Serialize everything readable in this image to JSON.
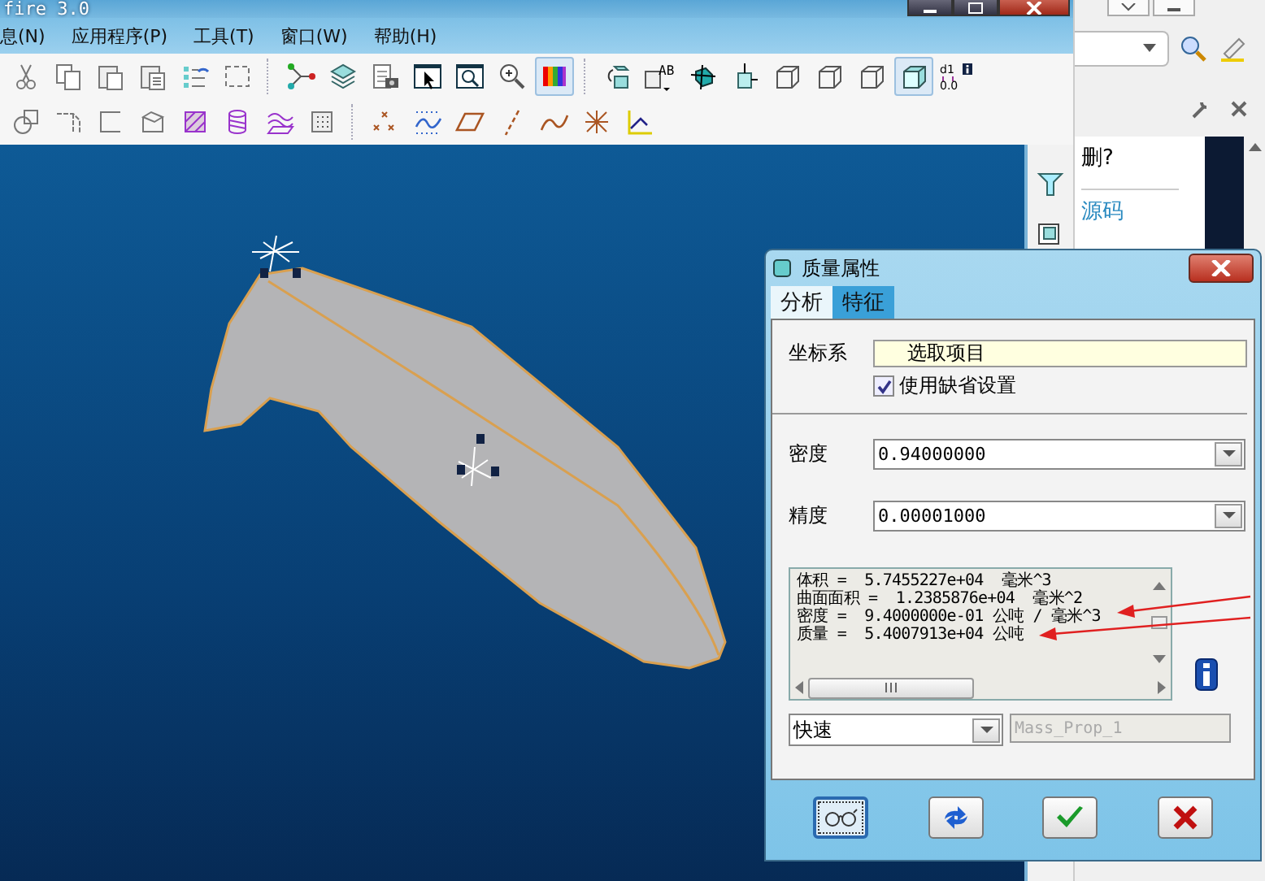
{
  "window": {
    "title": "fire 3.0"
  },
  "menu": [
    {
      "label": "息(N)"
    },
    {
      "label": "应用程序(P)"
    },
    {
      "label": "工具(T)"
    },
    {
      "label": "窗口(W)"
    },
    {
      "label": "帮助(H)"
    }
  ],
  "toolbars": [
    [
      {
        "kind": "scissors",
        "pressed": false
      },
      {
        "kind": "copy",
        "pressed": false
      },
      {
        "kind": "clipboard",
        "pressed": false
      },
      {
        "kind": "clipboard-list",
        "pressed": false
      },
      {
        "kind": "list-arrows",
        "pressed": false
      },
      {
        "kind": "dashed-rect",
        "pressed": false
      },
      {
        "kind": "node-graph",
        "pressed": false
      },
      {
        "kind": "layers",
        "pressed": false
      },
      {
        "kind": "table-camera",
        "pressed": false
      },
      {
        "kind": "cursor-window",
        "pressed": false
      },
      {
        "kind": "zoom-window",
        "pressed": false
      },
      {
        "kind": "zoom-in",
        "pressed": false
      },
      {
        "kind": "color-bars",
        "pressed": true
      },
      {
        "kind": "cube-arrow",
        "pressed": false
      },
      {
        "kind": "cube-text",
        "label": "AB",
        "pressed": false
      },
      {
        "kind": "cube-axes",
        "pressed": false
      },
      {
        "kind": "cube-arrows",
        "pressed": false
      },
      {
        "kind": "wire-cube",
        "pressed": false
      },
      {
        "kind": "wire-cube",
        "pressed": false
      },
      {
        "kind": "wire-cube",
        "pressed": false
      },
      {
        "kind": "shaded-cube",
        "pressed": true
      },
      {
        "kind": "dim-text",
        "label": "d1",
        "sublabel": "0.0",
        "pressed": false
      }
    ],
    [
      {
        "kind": "circle-square",
        "pressed": false
      },
      {
        "kind": "corner-line",
        "pressed": false
      },
      {
        "kind": "bracket",
        "pressed": false
      },
      {
        "kind": "open-box",
        "pressed": false
      },
      {
        "kind": "hatched-square",
        "pressed": false
      },
      {
        "kind": "cylinder",
        "pressed": false
      },
      {
        "kind": "wave-plane",
        "pressed": false
      },
      {
        "kind": "grid-square",
        "pressed": false
      },
      {
        "kind": "cross-points",
        "pressed": false
      },
      {
        "kind": "curve-grid",
        "pressed": false
      },
      {
        "kind": "parallelogram",
        "pressed": false
      },
      {
        "kind": "dashed-line",
        "pressed": false
      },
      {
        "kind": "curve",
        "pressed": false
      },
      {
        "kind": "star-axes",
        "pressed": false
      },
      {
        "kind": "axis-angle",
        "pressed": false
      }
    ]
  ],
  "right_panel": {
    "question": "删?",
    "tab": "源码"
  },
  "dialog": {
    "title": "质量属性",
    "tabs": [
      {
        "label": "分析",
        "selected": true
      },
      {
        "label": "特征",
        "selected": false
      }
    ],
    "coordinate_system": {
      "label": "坐标系",
      "value": "选取项目",
      "checkbox": {
        "label": "使用缺省设置",
        "checked": true
      }
    },
    "density": {
      "label": "密度",
      "value": "0.94000000"
    },
    "accuracy": {
      "label": "精度",
      "value": "0.00001000"
    },
    "results": [
      "体积 =  5.7455227e+04  毫米^3",
      "曲面面积 =  1.2385876e+04  毫米^2",
      "密度 =  9.4000000e-01 公吨 / 毫米^3",
      "质量 =  5.4007913e+04 公吨"
    ],
    "mode": {
      "value": "快速"
    },
    "name_field": {
      "value": "Mass_Prop_1",
      "disabled": true
    },
    "buttons": [
      {
        "kind": "glasses",
        "focused": true
      },
      {
        "kind": "refresh",
        "focused": false
      },
      {
        "kind": "ok",
        "focused": false
      },
      {
        "kind": "cancel",
        "focused": false
      }
    ]
  }
}
